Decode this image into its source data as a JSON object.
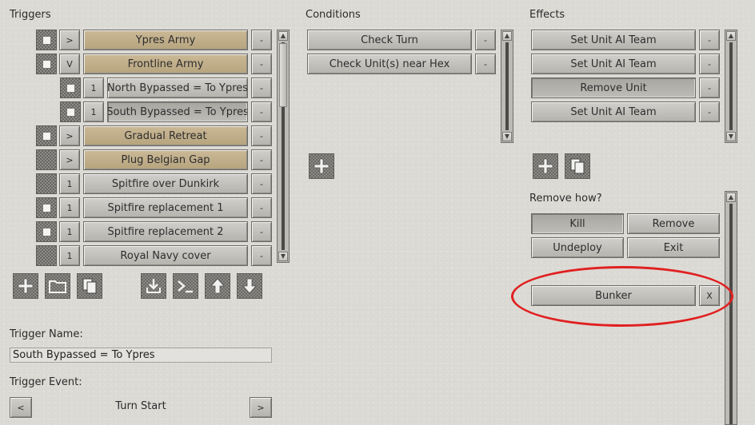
{
  "headers": {
    "triggers": "Triggers",
    "conditions": "Conditions",
    "effects": "Effects"
  },
  "triggers": [
    {
      "name": "Ypres Army",
      "toggle": ">",
      "remove": "-"
    },
    {
      "name": "Frontline Army",
      "toggle": "V",
      "remove": "-"
    },
    {
      "name": "North Bypassed = To Ypres",
      "toggle": "1",
      "remove": "-"
    },
    {
      "name": "South Bypassed = To Ypres",
      "toggle": "1",
      "remove": "-"
    },
    {
      "name": "Gradual Retreat",
      "toggle": ">",
      "remove": "-"
    },
    {
      "name": "Plug Belgian Gap",
      "toggle": ">",
      "remove": "-"
    },
    {
      "name": "Spitfire over Dunkirk",
      "toggle": "1",
      "remove": "-"
    },
    {
      "name": "Spitfire replacement 1",
      "toggle": "1",
      "remove": "-"
    },
    {
      "name": "Spitfire replacement 2",
      "toggle": "1",
      "remove": "-"
    },
    {
      "name": "Royal Navy cover",
      "toggle": "1",
      "remove": "-"
    }
  ],
  "conditions": [
    {
      "name": "Check Turn",
      "remove": "-"
    },
    {
      "name": "Check Unit(s) near Hex",
      "remove": "-"
    }
  ],
  "effects": [
    {
      "name": "Set Unit AI Team",
      "remove": "-"
    },
    {
      "name": "Set Unit AI Team",
      "remove": "-"
    },
    {
      "name": "Remove Unit",
      "remove": "-"
    },
    {
      "name": "Set Unit AI Team",
      "remove": "-"
    }
  ],
  "remove_how": {
    "label": "Remove how?",
    "options": [
      "Kill",
      "Remove",
      "Undeploy",
      "Exit"
    ],
    "selected": "Kill"
  },
  "unit": {
    "name": "Bunker",
    "clear": "X"
  },
  "trigger_name": {
    "label": "Trigger Name:",
    "value": "South Bypassed = To Ypres"
  },
  "trigger_event": {
    "label": "Trigger Event:",
    "value": "Turn Start",
    "prev": "<",
    "next": ">"
  },
  "colors": {
    "tan": "#c1ae89",
    "highlight": "#e02020"
  }
}
